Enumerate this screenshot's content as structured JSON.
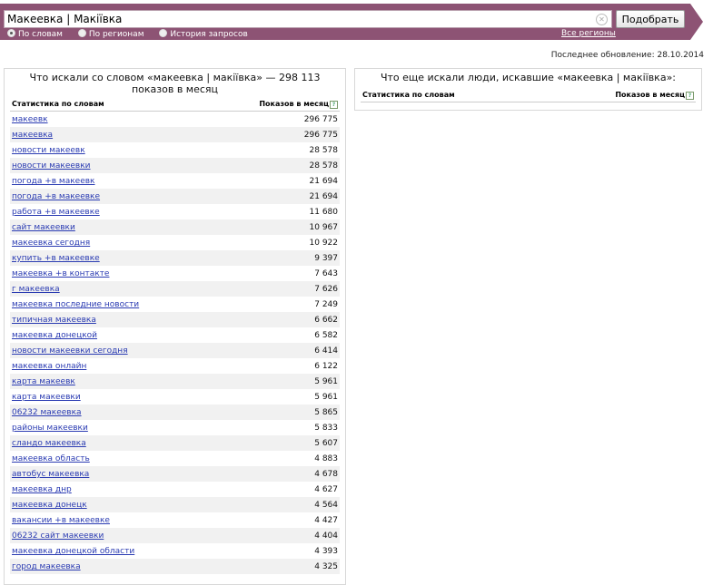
{
  "search": {
    "value": "Макеевка | Макіївка",
    "button_label": "Подобрать"
  },
  "modes": [
    {
      "label": "По словам",
      "selected": true
    },
    {
      "label": "По регионам",
      "selected": false
    },
    {
      "label": "История запросов",
      "selected": false
    }
  ],
  "all_regions_link": "Все регионы",
  "last_update": "Последнее обновление: 28.10.2014",
  "left_panel": {
    "title": "Что искали со словом «макеевка | макіївка» — 298 113 показов в месяц",
    "col_keyword": "Статистика по словам",
    "col_count": "Показов в месяц",
    "rows": [
      {
        "kw": "макеевк",
        "count": "296 775"
      },
      {
        "kw": "макеевка",
        "count": "296 775"
      },
      {
        "kw": "новости макеевк",
        "count": "28 578"
      },
      {
        "kw": "новости макеевки",
        "count": "28 578"
      },
      {
        "kw": "погода +в макеевк",
        "count": "21 694"
      },
      {
        "kw": "погода +в макеевке",
        "count": "21 694"
      },
      {
        "kw": "работа +в макеевке",
        "count": "11 680"
      },
      {
        "kw": "сайт макеевки",
        "count": "10 967"
      },
      {
        "kw": "макеевка сегодня",
        "count": "10 922"
      },
      {
        "kw": "купить +в макеевке",
        "count": "9 397"
      },
      {
        "kw": "макеевка +в контакте",
        "count": "7 643"
      },
      {
        "kw": "г макеевка",
        "count": "7 626"
      },
      {
        "kw": "макеевка последние новости",
        "count": "7 249"
      },
      {
        "kw": "типичная макеевка",
        "count": "6 662"
      },
      {
        "kw": "макеевка донецкой",
        "count": "6 582"
      },
      {
        "kw": "новости макеевки сегодня",
        "count": "6 414"
      },
      {
        "kw": "макеевка онлайн",
        "count": "6 122"
      },
      {
        "kw": "карта макеевк",
        "count": "5 961"
      },
      {
        "kw": "карта макеевки",
        "count": "5 961"
      },
      {
        "kw": "06232 макеевка",
        "count": "5 865"
      },
      {
        "kw": "районы макеевки",
        "count": "5 833"
      },
      {
        "kw": "сландо макеевка",
        "count": "5 607"
      },
      {
        "kw": "макеевка область",
        "count": "4 883"
      },
      {
        "kw": "автобус макеевка",
        "count": "4 678"
      },
      {
        "kw": "макеевка днр",
        "count": "4 627"
      },
      {
        "kw": "макеевка донецк",
        "count": "4 564"
      },
      {
        "kw": "вакансии +в макеевке",
        "count": "4 427"
      },
      {
        "kw": "06232 сайт макеевки",
        "count": "4 404"
      },
      {
        "kw": "макеевка донецкой области",
        "count": "4 393"
      },
      {
        "kw": "город макеевка",
        "count": "4 325"
      }
    ]
  },
  "right_panel": {
    "title": "Что еще искали люди, искавшие «макеевка | макіївка»:",
    "col_keyword": "Статистика по словам",
    "col_count": "Показов в месяц"
  },
  "colors": {
    "header": "#8d5374",
    "link": "#2a3bb2",
    "stripe": "#f1f1f1"
  }
}
